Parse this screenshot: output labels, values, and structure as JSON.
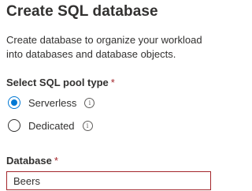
{
  "title": "Create SQL database",
  "description": {
    "line1": "Create database to organize your workload",
    "line2": "into databases and database objects."
  },
  "pool_type": {
    "label": "Select SQL pool type",
    "required_mark": "*",
    "options": [
      {
        "label": "Serverless",
        "selected": true
      },
      {
        "label": "Dedicated",
        "selected": false
      }
    ],
    "info_icon": "info-icon"
  },
  "database": {
    "label": "Database",
    "required_mark": "*",
    "value": "Beers"
  },
  "colors": {
    "accent": "#0078d4",
    "error_border": "#a4262c",
    "text": "#323130"
  }
}
